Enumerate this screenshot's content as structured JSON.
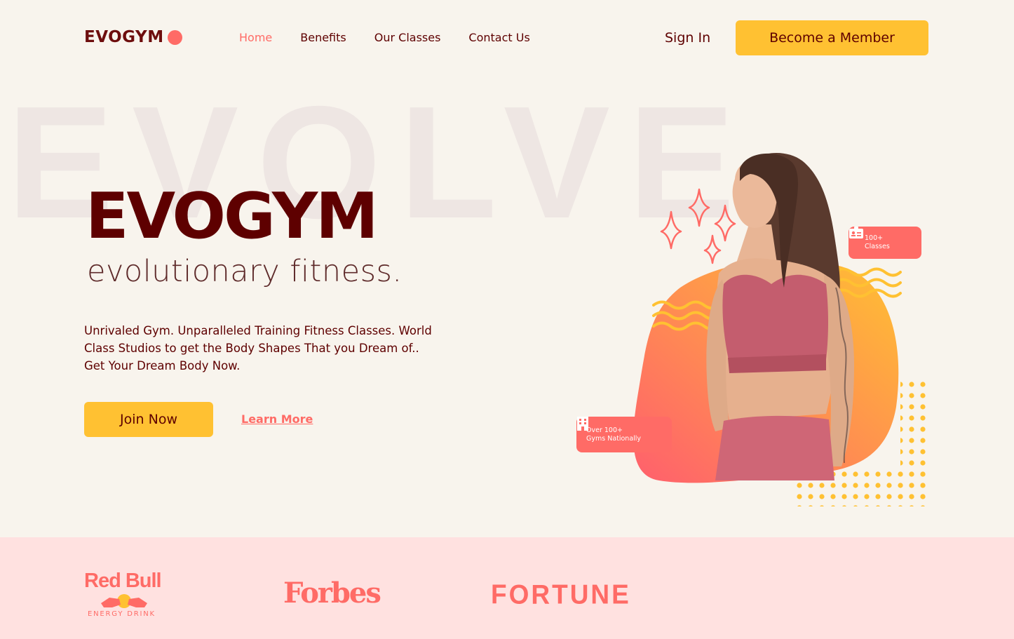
{
  "nav": {
    "logo": "EVOGYM",
    "links": [
      "Home",
      "Benefits",
      "Our Classes",
      "Contact Us"
    ],
    "active_link": "Home",
    "sign_in": "Sign In",
    "cta": "Become a Member"
  },
  "hero": {
    "background_word": "EVOLVE",
    "title": "EVOGYM",
    "subtitle": "evolutionary fitness.",
    "description": "Unrivaled Gym. Unparalleled Training Fitness Classes. World Class Studios to get the Body Shapes That you Dream of.. Get Your Dream Body Now.",
    "join_button": "Join Now",
    "learn_more": "Learn More",
    "badge_classes": [
      "100+",
      "Classes"
    ],
    "badge_gyms": [
      "Over 100+",
      "Gyms Nationally"
    ]
  },
  "sponsors": {
    "redbull": "Red Bull",
    "redbull_sub": "ENERGY DRINK",
    "forbes": "Forbes",
    "fortune": "FORTUNE"
  },
  "colors": {
    "background": "#f8f4ed",
    "primary_dark": "#5e0000",
    "accent_coral": "#ff6b66",
    "accent_yellow": "#ffc132",
    "sponsor_band": "#ffe1e0"
  },
  "icons": [
    "id-card-icon",
    "building-icon",
    "sparkle-icon"
  ]
}
